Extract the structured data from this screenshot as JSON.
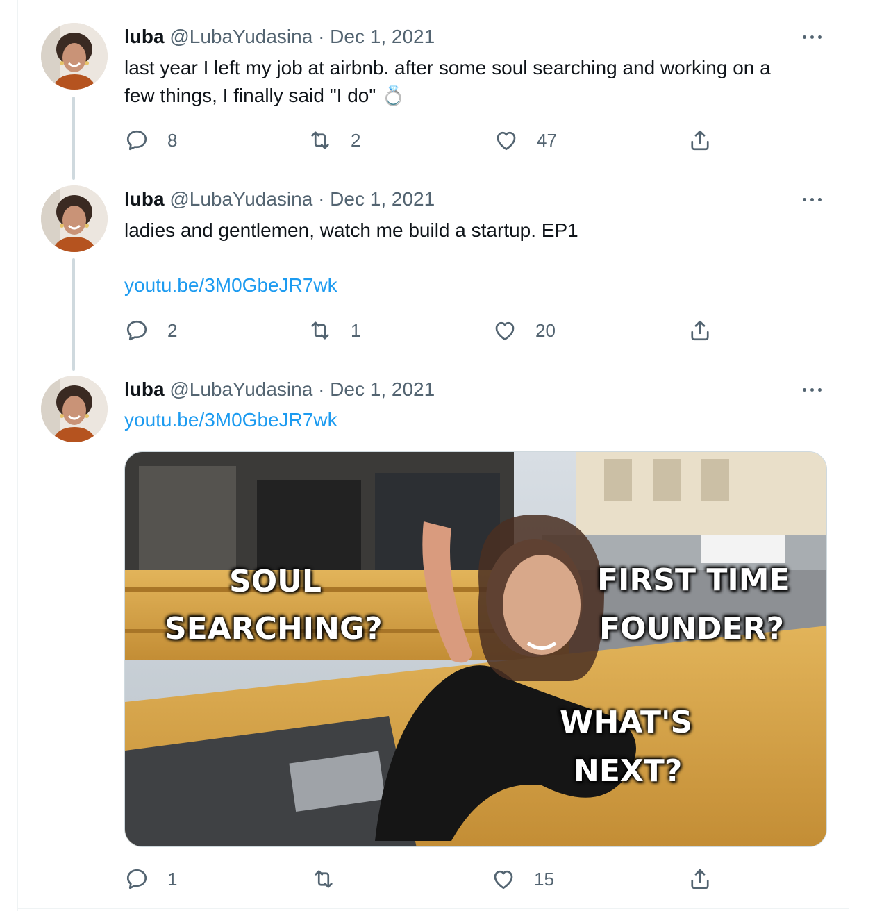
{
  "tweets": [
    {
      "name": "luba",
      "handle": "@LubaYudasina",
      "separator": "·",
      "date": "Dec 1, 2021",
      "line1": "last year I left my job at airbnb. after some soul searching and working on a",
      "line2": "few things, I finally said \"I do\"",
      "emoji": "💍",
      "replies": "8",
      "retweets": "2",
      "likes": "47"
    },
    {
      "name": "luba",
      "handle": "@LubaYudasina",
      "separator": "·",
      "date": "Dec 1, 2021",
      "line1": "ladies and gentlemen, watch me build a startup. EP1",
      "link": "youtu.be/3M0GbeJR7wk",
      "replies": "2",
      "retweets": "1",
      "likes": "20"
    },
    {
      "name": "luba",
      "handle": "@LubaYudasina",
      "separator": "·",
      "date": "Dec 1, 2021",
      "link": "youtu.be/3M0GbeJR7wk",
      "replies": "1",
      "retweets": "",
      "likes": "15",
      "media": {
        "text_left_1": "SOUL",
        "text_left_2": "SEARCHING?",
        "text_right_1": "FIRST TIME",
        "text_right_2": "FOUNDER?",
        "text_bottom_1": "WHAT'S",
        "text_bottom_2": "NEXT?"
      }
    }
  ],
  "colors": {
    "link": "#1d9bf0",
    "secondary": "#536471",
    "thread_line": "#cfd9de"
  }
}
